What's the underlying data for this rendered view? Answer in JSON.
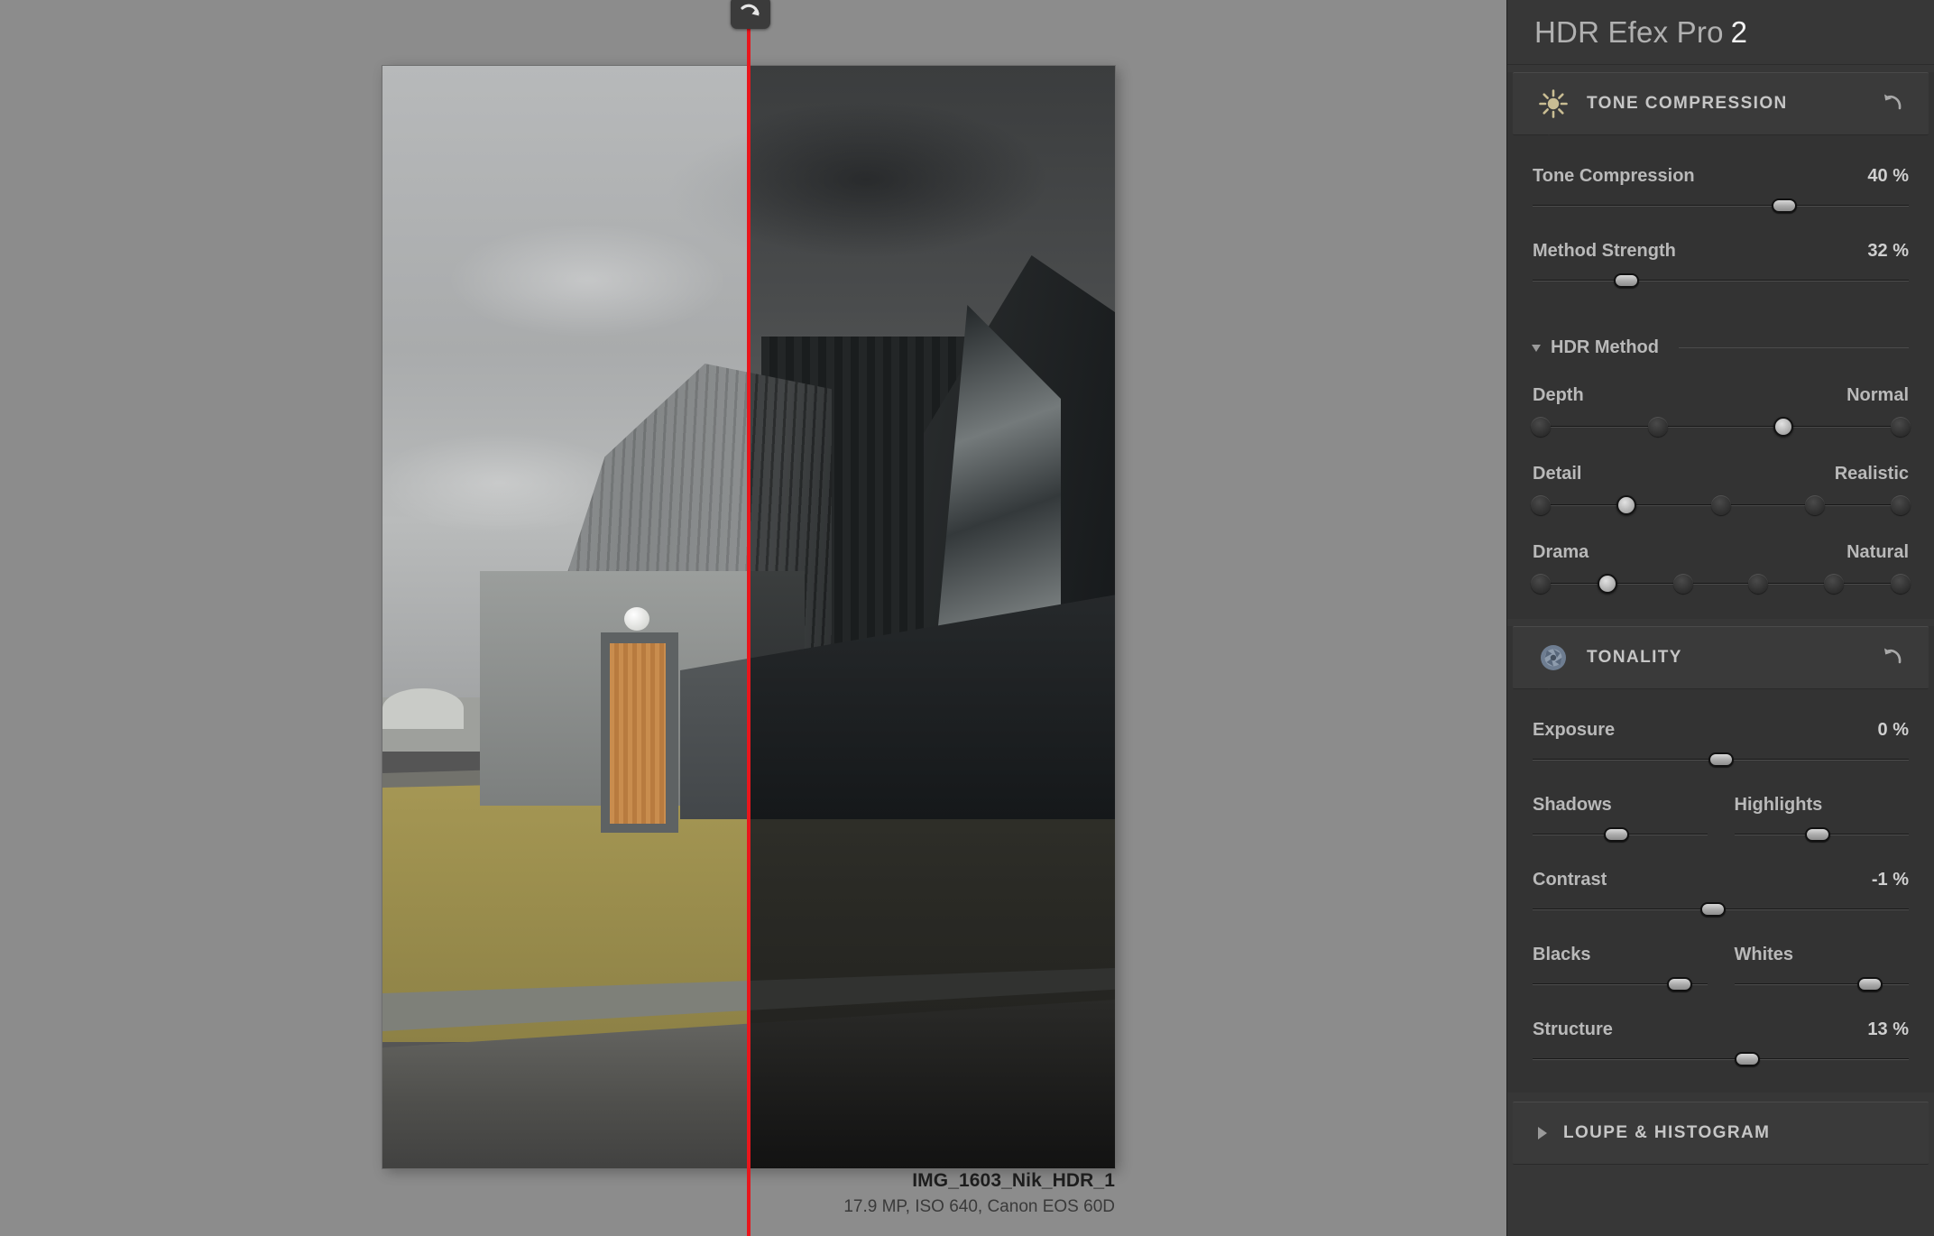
{
  "app": {
    "brand": "HDR Efex Pro",
    "version": "2"
  },
  "canvas": {
    "split_line_color": "#e8161c",
    "handle_icon": "curved-arrow-icon",
    "caption": {
      "title": "IMG_1603_Nik_HDR_1",
      "meta": "17.9 MP, ISO 640, Canon EOS 60D"
    }
  },
  "sections": [
    {
      "id": "tone-compression",
      "title": "TONE COMPRESSION",
      "icon": "sun-icon",
      "reset_icon": "reset-arrow-icon",
      "expanded": true,
      "sliders": [
        {
          "label": "Tone Compression",
          "value": "40 %",
          "pos": 67
        },
        {
          "label": "Method Strength",
          "value": "32 %",
          "pos": 25
        }
      ],
      "subgroup": {
        "title": "HDR Method",
        "expanded": true,
        "notch_sliders": [
          {
            "label": "Depth",
            "option": "Normal",
            "notches": 4,
            "selected": 2
          },
          {
            "label": "Detail",
            "option": "Realistic",
            "notches": 5,
            "selected": 1
          },
          {
            "label": "Drama",
            "option": "Natural",
            "notches": 6,
            "selected": 1
          }
        ]
      }
    },
    {
      "id": "tonality",
      "title": "TONALITY",
      "icon": "aperture-icon",
      "reset_icon": "reset-arrow-icon",
      "expanded": true,
      "sliders": [
        {
          "label": "Exposure",
          "value": "0 %",
          "pos": 50
        }
      ],
      "pairs": [
        {
          "left": {
            "label": "Shadows",
            "pos": 48
          },
          "right": {
            "label": "Highlights",
            "pos": 48
          }
        },
        {
          "left": {
            "label": "Blacks",
            "pos": 84
          },
          "right": {
            "label": "Whites",
            "pos": 78
          }
        }
      ],
      "sliders_after": [
        {
          "label": "Structure",
          "value": "13 %",
          "pos": 57
        }
      ]
    },
    {
      "id": "loupe-histogram",
      "title": "LOUPE & HISTOGRAM",
      "icon": "triangle-right-icon",
      "expanded": false
    }
  ]
}
